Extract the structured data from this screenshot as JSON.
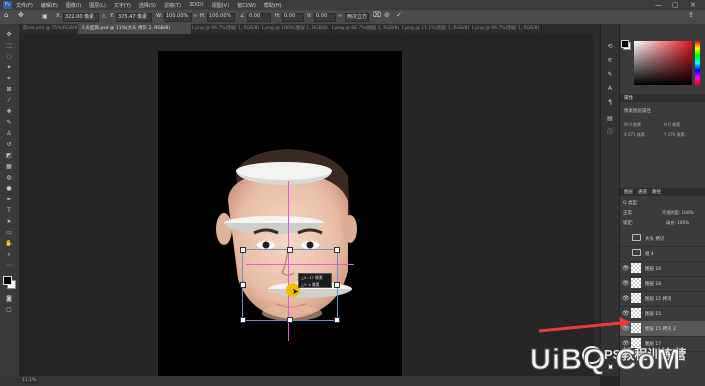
{
  "menubar": {
    "app_logo": "Ps",
    "items": [
      "文件(F)",
      "编辑(E)",
      "图像(I)",
      "图层(L)",
      "文字(Y)",
      "选择(S)",
      "滤镜(T)",
      "3D(D)",
      "视图(V)",
      "窗口(W)",
      "帮助(H)"
    ],
    "win_min": "—",
    "win_max": "▢",
    "win_close": "✕"
  },
  "options_bar": {
    "x_value": "322.00 像素",
    "y_value": "375.47 像素",
    "w_value": "100.00%",
    "h_value": "100.00%",
    "angle_value": "0.00",
    "h_skew": "0.00",
    "v_skew": "0.00",
    "interp": "两次立方"
  },
  "tabs": [
    {
      "label": "肌ner.psd @ 75%(RGB/8)"
    },
    {
      "label": "人头挂饰.psd @ 11%(大头 拷贝 2, RGB/8)",
      "active": true
    },
    {
      "label": "1.png @ 66.7%(图层 1, RGB/8)"
    },
    {
      "label": "1.png @ 100%(图层 1, RGB/8)"
    },
    {
      "label": "1.png @ 66.7%(图层 1, RGB/8)"
    },
    {
      "label": "1.png @ 11.1%(图层 1, RGB/8)"
    },
    {
      "label": "1.png @ 66.7%(图层 1, RGB/8)"
    }
  ],
  "canvas": {
    "tooltip_line1": "△X: 37 像素",
    "tooltip_line2": "△Y: 4 像素"
  },
  "status": {
    "zoom_text": "11.1%"
  },
  "panels": {
    "properties_header": "属性",
    "properties_sub": "像素图层属性",
    "prop_w": "W  0 像素",
    "prop_h": "H  0 像素",
    "prop_x": "X  471 像素",
    "prop_y": "Y  476 像素",
    "layers_header": "图层",
    "channels_tab": "通道",
    "paths_tab": "路径",
    "kind_label": "Q 类型",
    "blend_mode": "正常",
    "opacity": "不透明度: 100%",
    "fill": "填充: 100%",
    "lock": "锁定:"
  },
  "layers": [
    {
      "name": "大头 拷贝",
      "type": "group"
    },
    {
      "name": "组 4",
      "type": "group"
    },
    {
      "name": "图层 16",
      "type": "pixel"
    },
    {
      "name": "图层 18",
      "type": "pixel"
    },
    {
      "name": "图层 15 拷贝",
      "type": "pixel"
    },
    {
      "name": "图层 15",
      "type": "pixel"
    },
    {
      "name": "图层 15 拷贝 2",
      "type": "pixel",
      "selected": true
    },
    {
      "name": "图层 17",
      "type": "pixel"
    }
  ],
  "watermark": {
    "text1": "PS教程训练营",
    "text2": "UiBQ.CoM"
  },
  "colors": {
    "accent": "#e63c3c",
    "guide": "#e05ad6",
    "handle": "#f0c000"
  }
}
